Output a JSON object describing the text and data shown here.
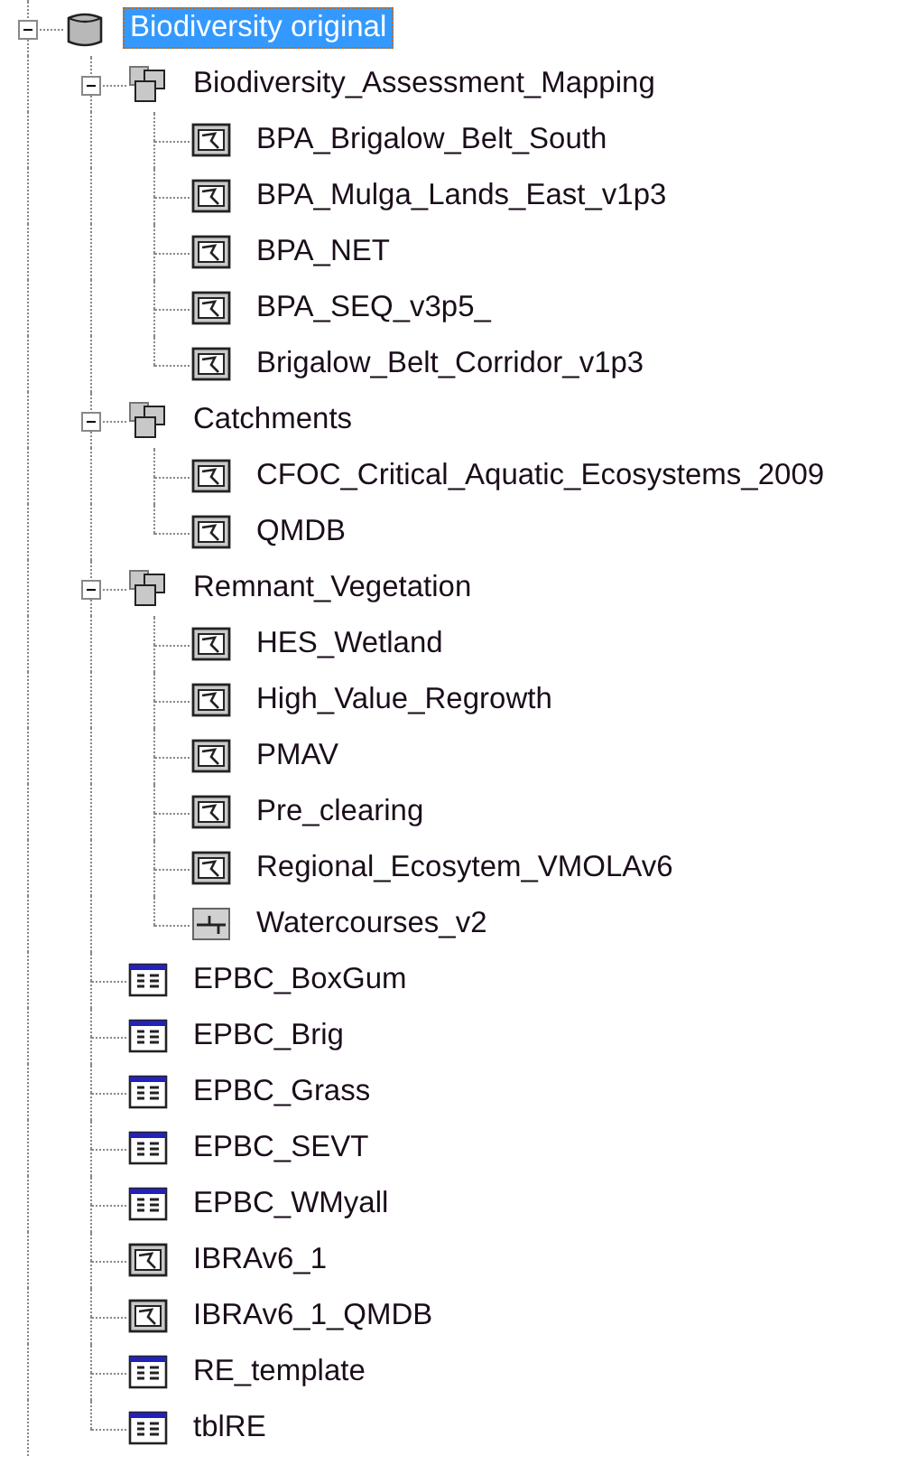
{
  "tree": [
    {
      "label": "Biodiversity original",
      "kind": "database",
      "expanded": true,
      "selected": true,
      "children": [
        {
          "label": "Biodiversity_Assessment_Mapping",
          "kind": "dataset",
          "expanded": true,
          "selected": false,
          "children": [
            {
              "label": "BPA_Brigalow_Belt_South",
              "kind": "polygon",
              "selected": false
            },
            {
              "label": "BPA_Mulga_Lands_East_v1p3",
              "kind": "polygon",
              "selected": false
            },
            {
              "label": "BPA_NET",
              "kind": "polygon",
              "selected": false
            },
            {
              "label": "BPA_SEQ_v3p5_",
              "kind": "polygon",
              "selected": false
            },
            {
              "label": "Brigalow_Belt_Corridor_v1p3",
              "kind": "polygon",
              "selected": false
            }
          ]
        },
        {
          "label": "Catchments",
          "kind": "dataset",
          "expanded": true,
          "selected": false,
          "children": [
            {
              "label": "CFOC_Critical_Aquatic_Ecosystems_2009",
              "kind": "polygon",
              "selected": false
            },
            {
              "label": "QMDB",
              "kind": "polygon",
              "selected": false
            }
          ]
        },
        {
          "label": "Remnant_Vegetation",
          "kind": "dataset",
          "expanded": true,
          "selected": false,
          "children": [
            {
              "label": "HES_Wetland",
              "kind": "polygon",
              "selected": false
            },
            {
              "label": "High_Value_Regrowth",
              "kind": "polygon",
              "selected": false
            },
            {
              "label": "PMAV",
              "kind": "polygon",
              "selected": false
            },
            {
              "label": "Pre_clearing",
              "kind": "polygon",
              "selected": false
            },
            {
              "label": "Regional_Ecosytem_VMOLAv6",
              "kind": "polygon",
              "selected": false
            },
            {
              "label": "Watercourses_v2",
              "kind": "line",
              "selected": false
            }
          ]
        },
        {
          "label": "EPBC_BoxGum",
          "kind": "table",
          "selected": false
        },
        {
          "label": "EPBC_Brig",
          "kind": "table",
          "selected": false
        },
        {
          "label": "EPBC_Grass",
          "kind": "table",
          "selected": false
        },
        {
          "label": "EPBC_SEVT",
          "kind": "table",
          "selected": false
        },
        {
          "label": "EPBC_WMyall",
          "kind": "table",
          "selected": false
        },
        {
          "label": "IBRAv6_1",
          "kind": "polygon",
          "selected": false
        },
        {
          "label": "IBRAv6_1_QMDB",
          "kind": "polygon",
          "selected": false
        },
        {
          "label": "RE_template",
          "kind": "table",
          "selected": false
        },
        {
          "label": "tblRE",
          "kind": "table",
          "selected": false
        }
      ]
    }
  ]
}
